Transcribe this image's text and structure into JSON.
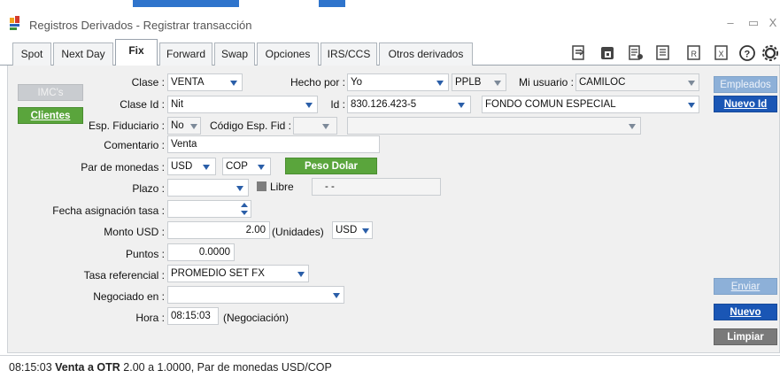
{
  "window": {
    "title": "Registros Derivados - Registrar transacción",
    "controls": {
      "minimize": "–",
      "maximize": "▭",
      "close": "X"
    }
  },
  "tabs": [
    {
      "label": "Spot"
    },
    {
      "label": "Next Day"
    },
    {
      "label": "Fix",
      "active": true
    },
    {
      "label": "Forward"
    },
    {
      "label": "Swap"
    },
    {
      "label": "Opciones"
    },
    {
      "label": "IRS/CCS"
    },
    {
      "label": "Otros derivados"
    }
  ],
  "toolbar_icons": [
    "export-icon",
    "print-icon",
    "report-icon",
    "list-icon",
    "r-file-icon",
    "excel-icon",
    "help-icon",
    "settings-icon"
  ],
  "side_buttons": {
    "imcs": "IMC's",
    "clientes": "Clientes",
    "empleados": "Empleados",
    "nuevo_id": "Nuevo Id",
    "enviar": "Enviar",
    "nuevo": "Nuevo",
    "limpiar": "Limpiar"
  },
  "form": {
    "clase": {
      "label": "Clase :",
      "value": "VENTA"
    },
    "hecho_por": {
      "label": "Hecho por :",
      "value": "Yo",
      "code": "PPLB"
    },
    "mi_usuario": {
      "label": "Mi usuario :",
      "value": "CAMILOC"
    },
    "clase_id": {
      "label": "Clase Id :",
      "value": "Nit"
    },
    "id": {
      "label": "Id :",
      "value": "830.126.423-5",
      "name": "FONDO COMUN ESPECIAL"
    },
    "esp_fiduciario": {
      "label": "Esp. Fiduciario :",
      "value": "No"
    },
    "codigo_esp_fid": {
      "label": "Código Esp. Fid :",
      "value": "",
      "description": ""
    },
    "comentario": {
      "label": "Comentario :",
      "value": "Venta"
    },
    "par_monedas": {
      "label": "Par de monedas :",
      "from": "USD",
      "to": "COP",
      "button": "Peso Dolar"
    },
    "plazo": {
      "label": "Plazo :",
      "value": "",
      "libre_label": "Libre",
      "libre_value": "- -"
    },
    "fecha_asignacion": {
      "label": "Fecha asignación tasa :",
      "value": ""
    },
    "monto": {
      "label": "Monto USD :",
      "value": "2.00",
      "units": "(Unidades)",
      "currency": "USD"
    },
    "puntos": {
      "label": "Puntos :",
      "value": "0.0000"
    },
    "tasa_referencial": {
      "label": "Tasa referencial :",
      "value": "PROMEDIO SET FX"
    },
    "negociado_en": {
      "label": "Negociado en :",
      "value": ""
    },
    "hora": {
      "label": "Hora :",
      "value": "08:15:03",
      "note": "(Negociación)"
    }
  },
  "status": {
    "time": "08:15:03",
    "action": "Venta a OTR",
    "detail": "2.00 a 1.0000, Par de monedas USD/COP"
  }
}
